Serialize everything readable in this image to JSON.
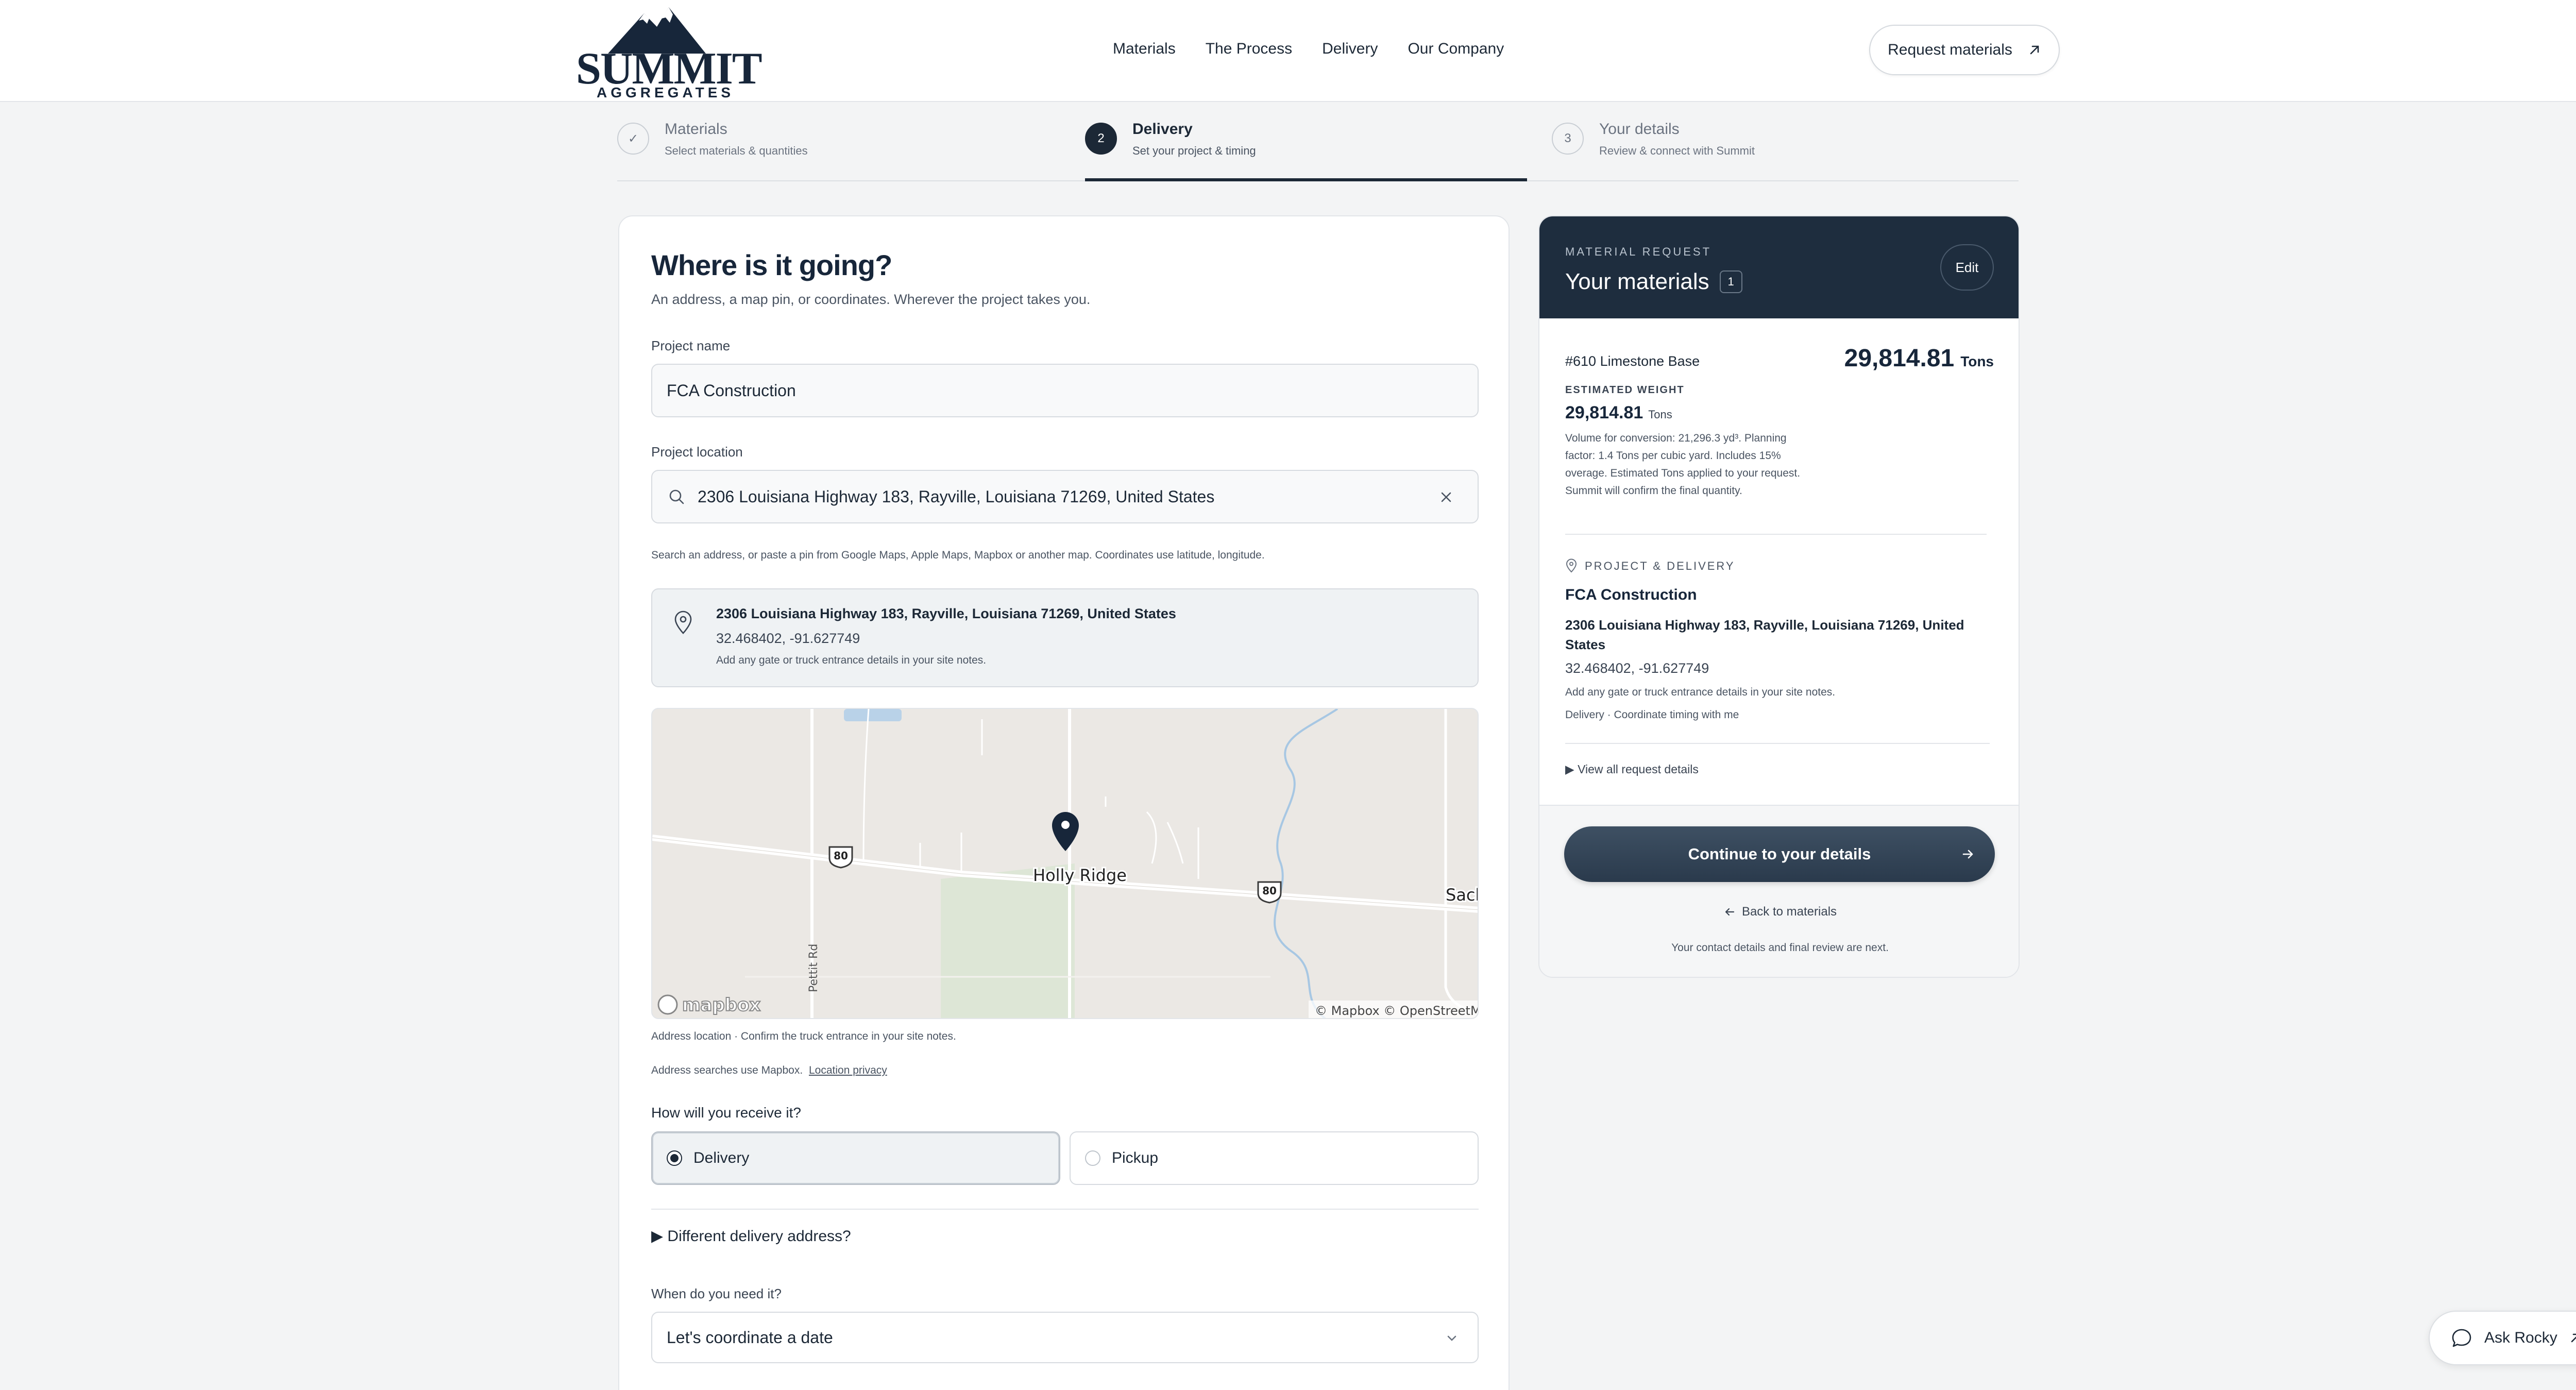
{
  "brand": {
    "name": "SUMMIT",
    "sub": "AGGREGATES"
  },
  "nav": [
    "Materials",
    "The Process",
    "Delivery",
    "Our Company"
  ],
  "header": {
    "request_label": "Request materials"
  },
  "stepper": [
    {
      "num": "✓",
      "title": "Materials",
      "sub": "Select materials & quantities"
    },
    {
      "num": "2",
      "title": "Delivery",
      "sub": "Set your project & timing"
    },
    {
      "num": "3",
      "title": "Your details",
      "sub": "Review & connect with Summit"
    }
  ],
  "form": {
    "title": "Where is it going?",
    "lead": "An address, a map pin, or coordinates. Wherever the project takes you.",
    "project_name_label": "Project name",
    "project_name_value": "FCA Construction",
    "project_location_label": "Project location",
    "project_location_value": "2306 Louisiana Highway 183, Rayville, Louisiana 71269, United States",
    "location_help": "Search an address, or paste a pin from Google Maps, Apple Maps, Mapbox or another map. Coordinates use latitude, longitude.",
    "location_box": {
      "address": "2306 Louisiana Highway 183, Rayville, Louisiana 71269, United States",
      "coords": "32.468402, -91.627749",
      "note": "Add any gate or truck entrance details in your site notes."
    },
    "map": {
      "place_center": "Holly Ridge",
      "place_right": "Sackson",
      "road_label": "Pettit Rd",
      "route_shield": "80",
      "logo": "mapbox",
      "attribution": "© Mapbox © OpenStreetMap"
    },
    "map_note": "Address location · Confirm the truck entrance in your site notes.",
    "map_privacy_prefix": "Address searches use Mapbox.",
    "map_privacy_link": "Location privacy",
    "receive_label": "How will you receive it?",
    "receive_options": [
      "Delivery",
      "Pickup"
    ],
    "different_address": "▶ Different delivery address?",
    "when_label": "When do you need it?",
    "when_value": "Let's coordinate a date"
  },
  "summary": {
    "kicker": "MATERIAL REQUEST",
    "title": "Your materials",
    "count": "1",
    "edit_label": "Edit",
    "item_name": "#610 Limestone Base",
    "item_amount": "29,814.81",
    "item_unit": "Tons",
    "est_label": "ESTIMATED WEIGHT",
    "est_value": "29,814.81",
    "est_unit": "Tons",
    "est_note": "Volume for conversion: 21,296.3 yd³. Planning factor: 1.4 Tons per cubic yard. Includes 15% overage. Estimated Tons applied to your request. Summit will confirm the final quantity.",
    "pd_label": "PROJECT & DELIVERY",
    "pd_name": "FCA Construction",
    "pd_address": "2306 Louisiana Highway 183, Rayville, Louisiana 71269, United States",
    "pd_coords": "32.468402, -91.627749",
    "pd_note": "Add any gate or truck entrance details in your site notes.",
    "pd_timing": "Delivery · Coordinate timing with me",
    "view_all": "▶ View all request details",
    "cta_label": "Continue to your details",
    "back_label": "Back to materials",
    "foot_note": "Your contact details and final review are next."
  },
  "assistant": {
    "label": "Ask Rocky"
  }
}
